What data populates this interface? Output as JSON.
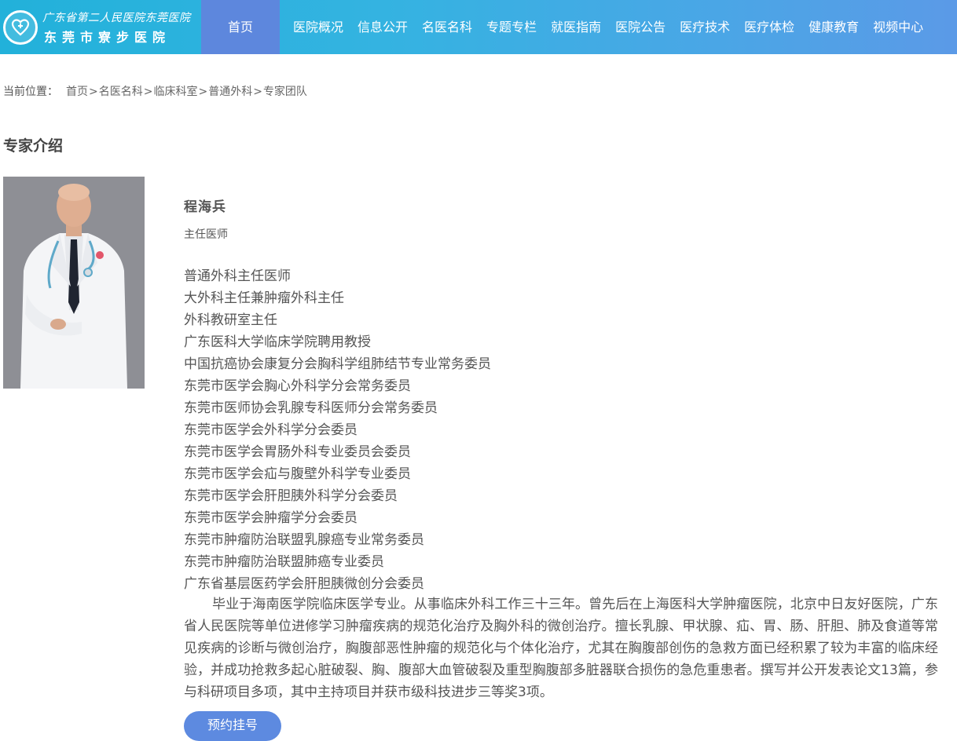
{
  "site": {
    "logo_line1": "广东省第二人民医院东莞医院",
    "logo_line2": "东莞市寮步医院"
  },
  "nav": [
    "首页",
    "医院概况",
    "信息公开",
    "名医名科",
    "专题专栏",
    "就医指南",
    "医院公告",
    "医疗技术",
    "医疗体检",
    "健康教育",
    "视频中心"
  ],
  "breadcrumb": {
    "label": "当前位置：",
    "items": [
      "首页",
      "名医名科",
      "临床科室",
      "普通外科",
      "专家团队"
    ],
    "separator": ">"
  },
  "section_title": "专家介绍",
  "doctor": {
    "name": "程海兵",
    "title": "主任医师",
    "positions": [
      "普通外科主任医师",
      "大外科主任兼肿瘤外科主任",
      "外科教研室主任",
      "广东医科大学临床学院聘用教授",
      "中国抗癌协会康复分会胸科学组肺结节专业常务委员",
      "东莞市医学会胸心外科学分会常务委员",
      "东莞市医师协会乳腺专科医师分会常务委员",
      "东莞市医学会外科学分会委员",
      "东莞市医学会胃肠外科专业委员会委员",
      "东莞市医学会疝与腹壁外科学专业委员",
      "东莞市医学会肝胆胰外科学分会委员",
      "东莞市医学会肿瘤学分会委员",
      "东莞市肿瘤防治联盟乳腺癌专业常务委员",
      "东莞市肿瘤防治联盟肺癌专业委员",
      "广东省基层医药学会肝胆胰微创分会委员"
    ],
    "bio": "毕业于海南医学院临床医学专业。从事临床外科工作三十三年。曾先后在上海医科大学肿瘤医院，北京中日友好医院，广东省人民医院等单位进修学习肿瘤疾病的规范化治疗及胸外科的微创治疗。擅长乳腺、甲状腺、疝、胃、肠、肝胆、肺及食道等常见疾病的诊断与微创治疗，胸腹部恶性肿瘤的规范化与个体化治疗，尤其在胸腹部创伤的急救方面已经积累了较为丰富的临床经验，并成功抢救多起心脏破裂、胸、腹部大血管破裂及重型胸腹部多脏器联合损伤的急危重患者。撰写并公开发表论文13篇，参与科研项目多项，其中主持项目并获市级科技进步三等奖3项。"
  },
  "appointment_button": "预约挂号",
  "colors": {
    "header_start": "#22b1da",
    "header_end": "#5b9ae7",
    "nav_active": "#5d87dd",
    "button": "#5d8ae0"
  }
}
